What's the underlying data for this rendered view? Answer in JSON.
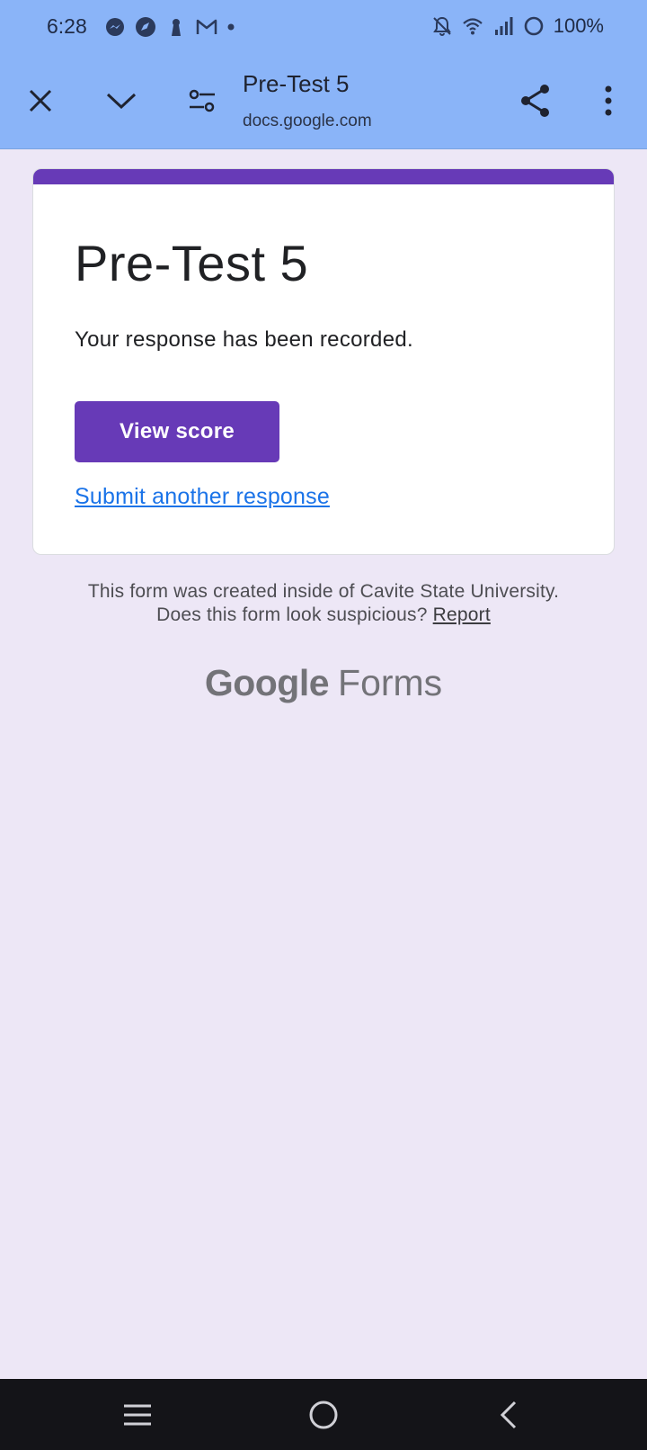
{
  "status_bar": {
    "time": "6:28",
    "left_icons": [
      "messenger-icon",
      "compass-icon",
      "keyhole-icon",
      "gmail-icon",
      "dot-icon"
    ],
    "right_icons": [
      "bell-off-icon",
      "wifi-icon",
      "signal-icon",
      "battery-ring-icon"
    ],
    "battery": "100%"
  },
  "toolbar": {
    "title": "Pre-Test 5",
    "url": "docs.google.com"
  },
  "form": {
    "title": "Pre-Test 5",
    "message": "Your response has been recorded.",
    "view_score_label": "View score",
    "submit_another_label": "Submit another response",
    "accent_color": "#673ab7"
  },
  "footer": {
    "line1": "This form was created inside of Cavite State University.",
    "line2_prefix": "Does this form look suspicious?",
    "report_label": "Report",
    "logo_google": "Google",
    "logo_forms": "Forms"
  },
  "colors": {
    "app_bar": "#8ab4f8",
    "page_bg": "#ede7f6",
    "link": "#1a73e8",
    "nav_bar": "#141418"
  }
}
